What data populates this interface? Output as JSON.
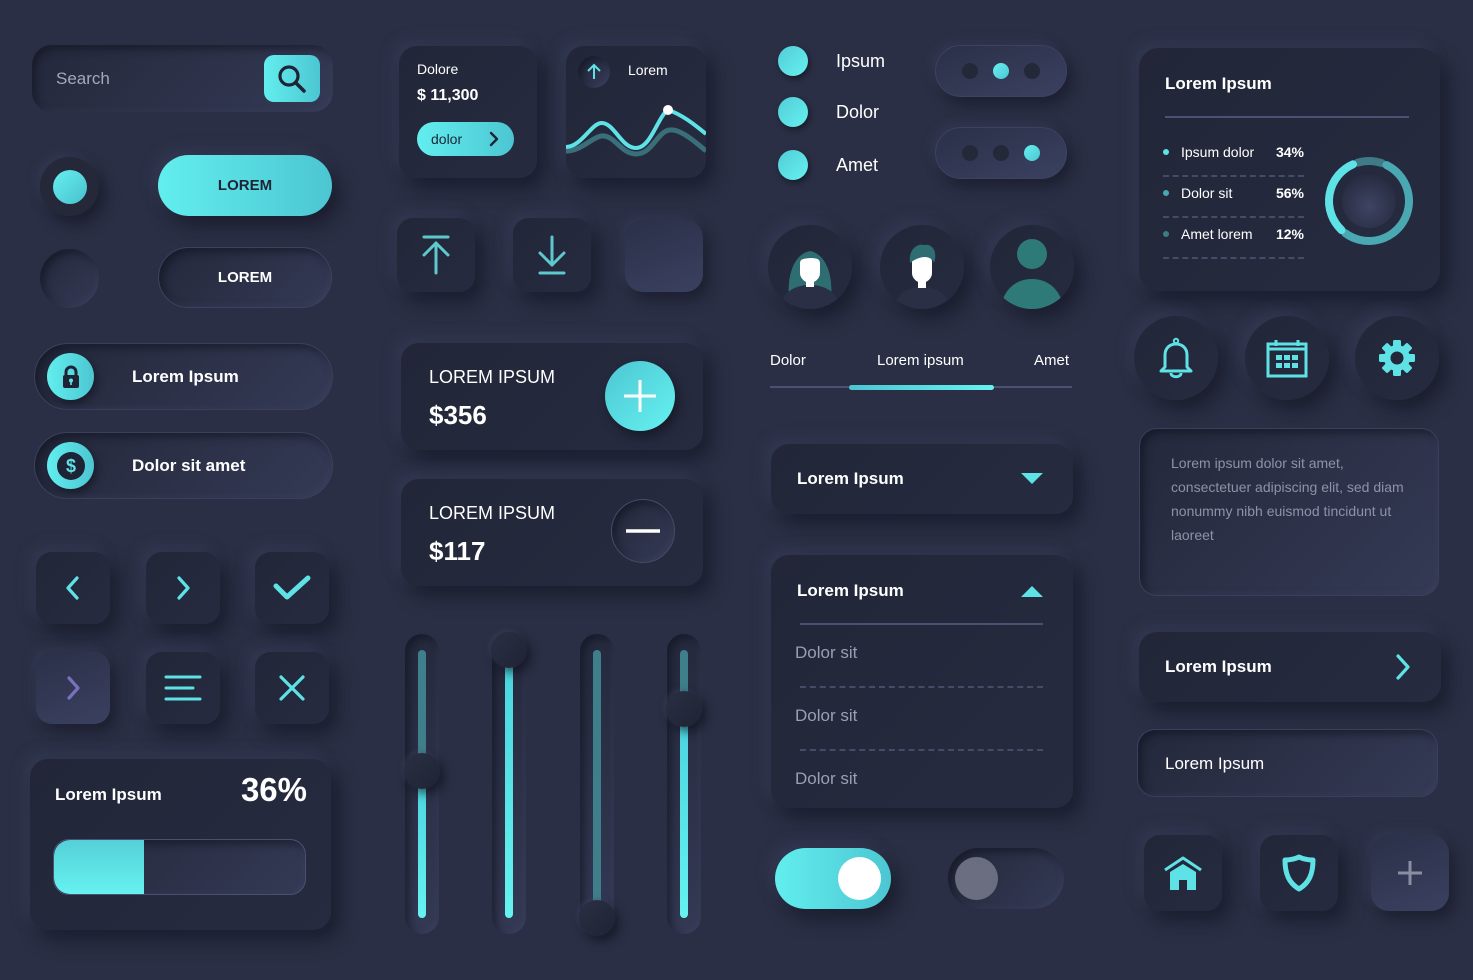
{
  "colors": {
    "background": "#2a2f45",
    "accent": "#5ee2e6",
    "accent_dark": "#3f7f8c",
    "text": "#ffffff",
    "muted_text": "#9a9fb3"
  },
  "search": {
    "placeholder": "Search",
    "value": "",
    "button_icon": "search-icon"
  },
  "radios_left": [
    {
      "state": "selected"
    },
    {
      "state": "unselected"
    }
  ],
  "buttons": {
    "primary_label": "LOREM",
    "secondary_label": "LOREM"
  },
  "pill_items": [
    {
      "label": "Lorem Ipsum",
      "icon": "lock-icon"
    },
    {
      "label": "Dolor sit amet",
      "icon": "dollar-icon"
    }
  ],
  "icon_buttons_left": [
    {
      "icon": "chevron-left-icon"
    },
    {
      "icon": "chevron-right-icon"
    },
    {
      "icon": "check-icon"
    },
    {
      "icon": "chevron-right-icon",
      "state": "pressed"
    },
    {
      "icon": "menu-icon"
    },
    {
      "icon": "close-icon"
    }
  ],
  "progress": {
    "title": "Lorem Ipsum",
    "value_label": "36%",
    "value": 0.36
  },
  "balance_card": {
    "label": "Dolore",
    "amount": "$ 11,300",
    "button_label": "dolor"
  },
  "trend_card": {
    "label": "Lorem",
    "icon": "arrow-up-icon"
  },
  "action_buttons": [
    {
      "icon": "upload-icon"
    },
    {
      "icon": "download-icon"
    },
    {
      "icon": "blank",
      "state": "pressed"
    }
  ],
  "money_cards": [
    {
      "label": "LOREM IPSUM",
      "amount": "$356",
      "action": "plus-icon"
    },
    {
      "label": "LOREM IPSUM",
      "amount": "$117",
      "action": "minus-icon"
    }
  ],
  "sliders": [
    {
      "value": 0.55
    },
    {
      "value": 1.0
    },
    {
      "value": 0.0
    },
    {
      "value": 0.78
    }
  ],
  "radio_list": [
    {
      "label": "Ipsum"
    },
    {
      "label": "Dolor"
    },
    {
      "label": "Amet"
    }
  ],
  "pagers": [
    {
      "active_index": 1,
      "count": 3
    },
    {
      "active_index": 2,
      "count": 3
    }
  ],
  "avatars": [
    {
      "type": "female"
    },
    {
      "type": "male"
    },
    {
      "type": "generic"
    }
  ],
  "tabs": {
    "items": [
      {
        "label": "Dolor"
      },
      {
        "label": "Lorem ipsum"
      },
      {
        "label": "Amet"
      }
    ],
    "active_index": 1
  },
  "dropdown_closed": {
    "label": "Lorem Ipsum"
  },
  "dropdown_open": {
    "label": "Lorem Ipsum",
    "options": [
      {
        "label": "Dolor sit"
      },
      {
        "label": "Dolor sit"
      },
      {
        "label": "Dolor sit"
      }
    ]
  },
  "toggles": [
    {
      "state": "on"
    },
    {
      "state": "off"
    }
  ],
  "stats_card": {
    "title": "Lorem Ipsum",
    "rows": [
      {
        "label": "Ipsum dolor",
        "value": "34%",
        "color": "#5ee2e6"
      },
      {
        "label": "Dolor sit",
        "value": "56%",
        "color": "#4aa8b2"
      },
      {
        "label": "Amet lorem",
        "value": "12%",
        "color": "#3f7a86"
      }
    ]
  },
  "round_buttons": [
    {
      "icon": "bell-icon"
    },
    {
      "icon": "calendar-icon"
    },
    {
      "icon": "gear-icon"
    }
  ],
  "textarea": {
    "text": "Lorem ipsum dolor sit amet, consectetuer adipiscing elit, sed diam nonummy nibh euismod tincidunt ut laoreet"
  },
  "nav_item": {
    "label": "Lorem Ipsum"
  },
  "input_field": {
    "value": "",
    "placeholder": "Lorem Ipsum"
  },
  "bottom_icons": [
    {
      "icon": "home-icon"
    },
    {
      "icon": "shield-icon"
    },
    {
      "icon": "plus-icon",
      "state": "pressed"
    }
  ]
}
